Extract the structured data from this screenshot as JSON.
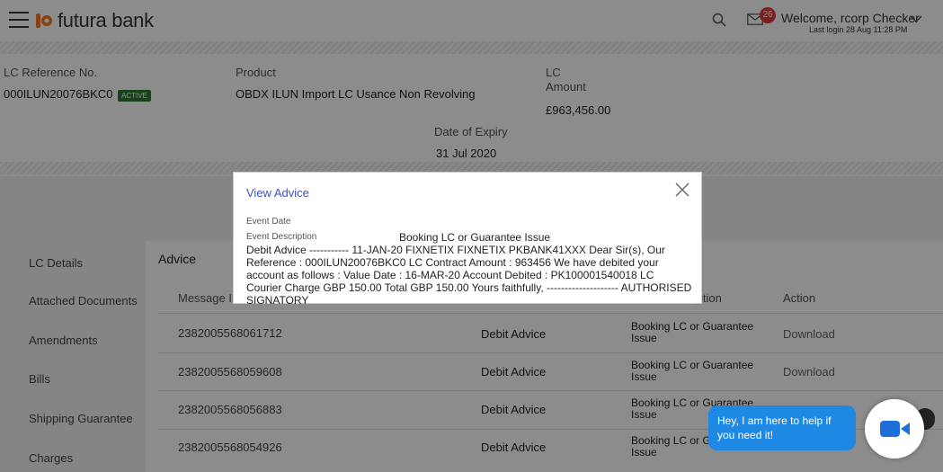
{
  "header": {
    "brand": "futura bank",
    "notification_count": "26",
    "welcome": "Welcome, rcorp Checker",
    "last_login": "Last login 28 Aug 11:28 PM"
  },
  "summary": {
    "lc_ref_label": "LC Reference No.",
    "lc_ref_value": "000ILUN20076BKC0",
    "status_badge": "ACTIVE",
    "product_label": "Product",
    "product_value": "OBDX ILUN Import LC Usance Non Revolving",
    "lc_label": "LC",
    "amount_label": "Amount",
    "amount_value": "£963,456.00",
    "expiry_label": "Date of Expiry",
    "expiry_value": "31 Jul 2020"
  },
  "nav": {
    "items": [
      "LC Details",
      "Attached Documents",
      "Amendments",
      "Bills",
      "Shipping Guarantee",
      "Charges"
    ]
  },
  "advice": {
    "title": "Advice",
    "columns": [
      "Message ID",
      "",
      "Event Description",
      "Action"
    ],
    "rows": [
      {
        "id": "2382005568061712",
        "type": "Debit Advice",
        "event": "Booking LC or Guarantee Issue",
        "action": "Download"
      },
      {
        "id": "2382005568059608",
        "type": "Debit Advice",
        "event": "Booking LC or Guarantee Issue",
        "action": "Download"
      },
      {
        "id": "2382005568056883",
        "type": "Debit Advice",
        "event": "Booking LC or Guarantee Issue",
        "action": ""
      },
      {
        "id": "2382005568054926",
        "type": "Debit Advice",
        "event": "Booking LC or Guarantee Issue",
        "action": ""
      }
    ]
  },
  "modal": {
    "title": "View Advice",
    "event_date_label": "Event Date",
    "event_desc_label": "Event Description",
    "event_desc_value": "Booking LC or Guarantee Issue",
    "body": "Debit Advice ----------- 11-JAN-20 FIXNETIX FIXNETIX PKBANK41XXX Dear Sir(s), Our Reference : 000ILUN20076BKC0 LC Contract Amount : 963456 We have debited your account as follows : Value Date : 16-MAR-20 Account Debited : PK100001540018 LC Courier Charge GBP 150.00 Total GBP 150.00 Yours faithfully, -------------------- AUTHORISED SIGNATORY"
  },
  "chat": {
    "message": "Hey, I am here to help if you need it!"
  },
  "colors": {
    "brand_orange": "#f47b20",
    "link_blue": "#3f51b5",
    "active_green": "#2e7d32",
    "badge_red": "#e53935",
    "chat_blue": "#1e88e5"
  }
}
